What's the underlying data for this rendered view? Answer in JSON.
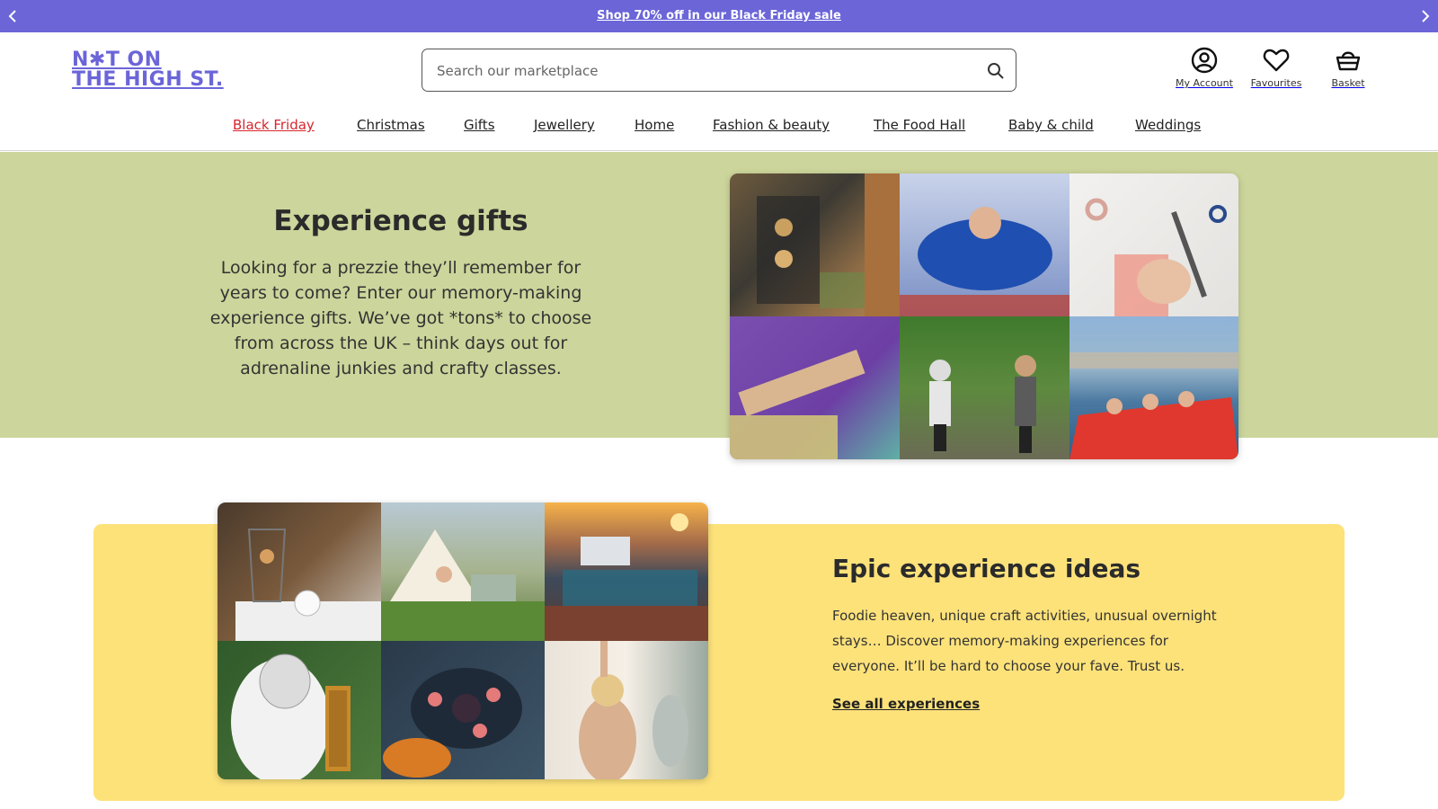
{
  "promo": {
    "text": "Shop 70% off in our Black Friday sale",
    "background": "#6b65d8"
  },
  "header": {
    "logo_line1": "N✱T ON",
    "logo_line2": "THE HIGH ST.",
    "brand_color": "#6b65d8",
    "search_placeholder": "Search our marketplace",
    "account_label": "My Account",
    "favourites_label": "Favourites",
    "basket_label": "Basket"
  },
  "nav": {
    "items": [
      {
        "label": "Black Friday",
        "highlight": true
      },
      {
        "label": "Christmas"
      },
      {
        "label": "Gifts"
      },
      {
        "label": "Jewellery"
      },
      {
        "label": "Home"
      },
      {
        "label": "Fashion & beauty"
      },
      {
        "label": "The Food Hall"
      },
      {
        "label": "Baby & child"
      },
      {
        "label": "Weddings"
      }
    ],
    "sale_color": "#d6262d"
  },
  "experience_gifts": {
    "title": "Experience gifts",
    "body": "Looking for a prezzie they’ll remember for years to come? Enter our memory-making experience gifts. We’ve got *tons* to choose from across the UK – think days out for adrenaline junkies and crafty classes.",
    "background": "#ccd59b",
    "images": [
      "afternoon-tea-tiers",
      "indoor-skydiving",
      "ring-making-class",
      "yoga-stretch",
      "segway-forest",
      "speedboat-thames"
    ]
  },
  "epic_ideas": {
    "title": "Epic experience ideas",
    "body": "Foodie heaven, unique craft activities, unusual overnight stays… Discover memory-making experiences for everyone. It’ll be hard to choose your fave. Trust us.",
    "link": "See all experiences",
    "background": "#fde27a",
    "images": [
      "afternoon-tea-service",
      "glamping-bell-tent",
      "rooftop-cinema",
      "beekeeping",
      "sushi-platter",
      "yoga-class"
    ]
  }
}
